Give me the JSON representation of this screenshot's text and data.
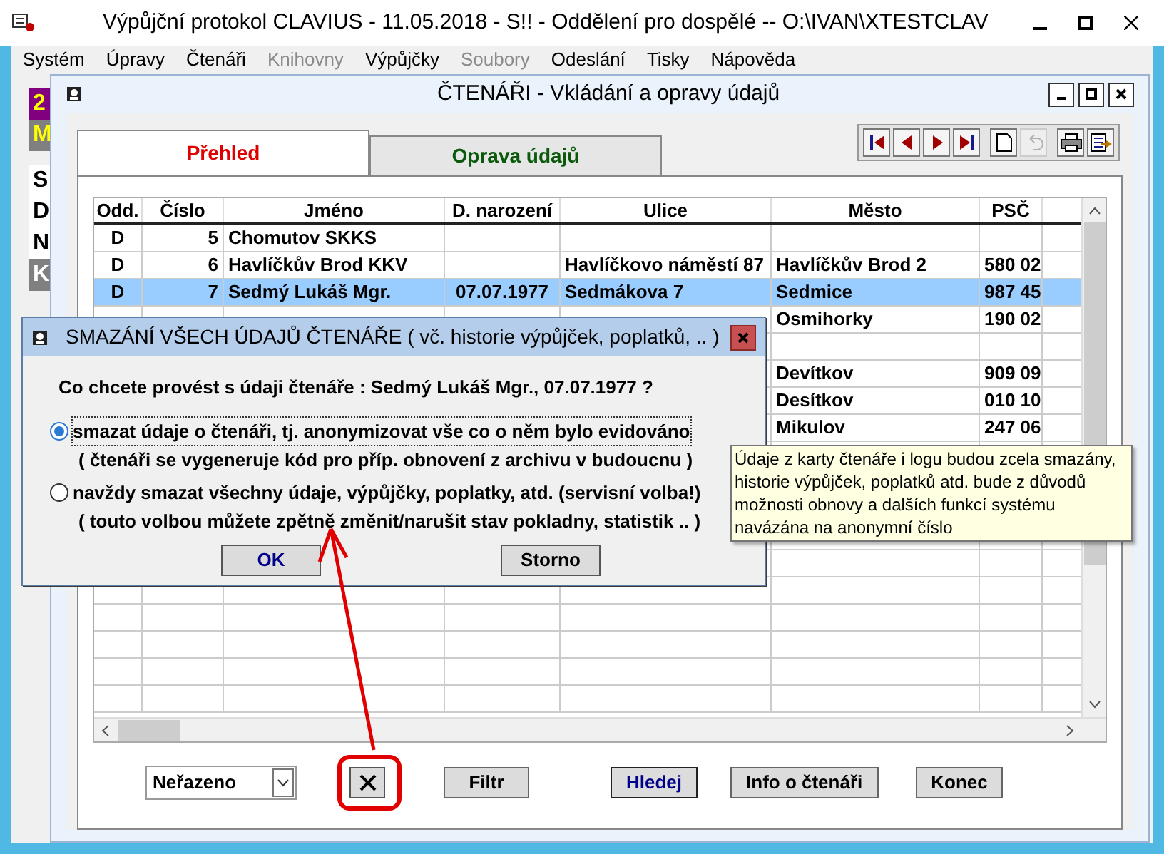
{
  "window": {
    "title": "Výpůjční protokol CLAVIUS - 11.05.2018 - S!! - Oddělení pro dospělé -- O:\\IVAN\\XTESTCLAV"
  },
  "menu": [
    {
      "label": "Systém",
      "disabled": false
    },
    {
      "label": "Úpravy",
      "disabled": false
    },
    {
      "label": "Čtenáři",
      "disabled": false
    },
    {
      "label": "Knihovny",
      "disabled": true
    },
    {
      "label": "Výpůjčky",
      "disabled": false
    },
    {
      "label": "Soubory",
      "disabled": true
    },
    {
      "label": "Odeslání",
      "disabled": false
    },
    {
      "label": "Tisky",
      "disabled": false
    },
    {
      "label": "Nápověda",
      "disabled": false
    }
  ],
  "background_panel": {
    "labels": [
      {
        "text": "2",
        "kind": "badge"
      },
      {
        "text": "M",
        "kind": "mode"
      },
      {
        "text": "S",
        "kind": "plain"
      },
      {
        "text": "D",
        "kind": "plain"
      },
      {
        "text": "N",
        "kind": "plain"
      },
      {
        "text": "K",
        "kind": "selected"
      }
    ]
  },
  "child_window": {
    "title": "ČTENÁŘI - Vkládání a opravy údajů",
    "tabs": [
      {
        "label": "Přehled",
        "selected": true
      },
      {
        "label": "Oprava údajů",
        "selected": false
      }
    ],
    "toolbar": [
      {
        "kind": "first",
        "disabled": false
      },
      {
        "kind": "prev",
        "disabled": false
      },
      {
        "kind": "next",
        "disabled": false
      },
      {
        "kind": "last",
        "disabled": false
      },
      {
        "kind": "new",
        "disabled": false
      },
      {
        "kind": "undo",
        "disabled": true
      },
      {
        "kind": "print",
        "disabled": false
      },
      {
        "kind": "export",
        "disabled": false
      }
    ],
    "table": {
      "columns": [
        "Odd.",
        "Číslo",
        "Jméno",
        "D. narození",
        "Ulice",
        "Město",
        "PSČ"
      ],
      "rows": [
        {
          "cells": [
            "D",
            "5",
            "Chomutov SKKS",
            null,
            null,
            null,
            null
          ],
          "selected": false
        },
        {
          "cells": [
            "D",
            "6",
            "Havlíčkův Brod KKV",
            null,
            "Havlíčkovo náměstí 87",
            "Havlíčkův Brod 2",
            "580 02"
          ],
          "selected": false
        },
        {
          "cells": [
            "D",
            "7",
            "Sedmý Lukáš Mgr.",
            "07.07.1977",
            "Sedmákova 7",
            "Sedmice",
            "987 45"
          ],
          "selected": true
        },
        {
          "cells": [
            null,
            null,
            null,
            null,
            null,
            "Osmihorky",
            "190 02"
          ],
          "selected": false
        },
        {
          "cells": [
            null,
            null,
            null,
            null,
            null,
            null,
            null
          ],
          "selected": false
        },
        {
          "cells": [
            null,
            null,
            null,
            null,
            null,
            "Devítkov",
            "909 09"
          ],
          "selected": false
        },
        {
          "cells": [
            null,
            null,
            null,
            null,
            null,
            "Desítkov",
            "010 10"
          ],
          "selected": false
        },
        {
          "cells": [
            null,
            null,
            null,
            null,
            null,
            "Mikulov",
            "247 06"
          ],
          "selected": false
        }
      ]
    },
    "sort_select": {
      "value": "Neřazeno"
    },
    "buttons": [
      {
        "kind": "icon"
      },
      {
        "kind": "text",
        "label": "Filtr",
        "default": false
      },
      {
        "kind": "text",
        "label": "Hledej",
        "default": true
      },
      {
        "kind": "text",
        "label": "Info o čtenáři",
        "default": false
      },
      {
        "kind": "text",
        "label": "Konec",
        "default": false
      }
    ]
  },
  "dialog": {
    "title": "SMAZÁNÍ VŠECH ÚDAJŮ ČTENÁŘE ( vč. historie výpůjček, poplatků, .. )",
    "question": "Co chcete provést s údaji čtenáře : Sedmý Lukáš Mgr., 07.07.1977 ?",
    "options": [
      {
        "label": "smazat údaje o čtenáři, tj. anonymizovat vše co o něm bylo evidováno",
        "note": "( čtenáři se vygeneruje kód pro příp. obnovení z archivu v budoucnu )",
        "selected": true
      },
      {
        "label": "navždy smazat všechny údaje, výpůjčky, poplatky, atd. (servisní volba!)",
        "note": "( touto volbou můžete zpětně změnit/narušit stav pokladny, statistik .. )",
        "selected": false
      }
    ],
    "buttons": [
      {
        "label": "OK",
        "default": true
      },
      {
        "label": "Storno",
        "default": false
      }
    ]
  },
  "tooltip": {
    "text": "Údaje z karty čtenáře i logu budou zcela smazány, historie výpůjček, poplatků atd. bude z důvodů možnosti obnovy a dalších funkcí systému navázána na anonymní číslo"
  }
}
